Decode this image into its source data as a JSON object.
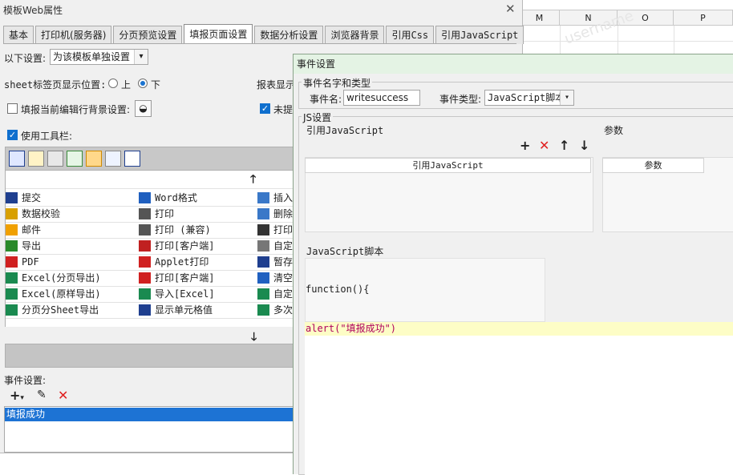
{
  "main": {
    "title": "模板Web属性",
    "tabs": [
      "基本",
      "打印机(服务器)",
      "分页预览设置",
      "填报页面设置",
      "数据分析设置",
      "浏览器背景",
      "引用Css",
      "引用JavaScript"
    ],
    "settings_label": "以下设置:",
    "settings_combo": "为该模板单独设置",
    "sheet_pos_label": "sheet标签页显示位置:",
    "radio_up": "上",
    "radio_down": "下",
    "report_display_label": "报表显示",
    "edit_row_bg_label": "填报当前编辑行背景设置:",
    "no_prompt_label": "未提",
    "use_toolbar_label": "使用工具栏:",
    "buttons": [
      [
        "提交",
        "Word格式",
        "插入"
      ],
      [
        "数据校验",
        "打印",
        "删除"
      ],
      [
        "邮件",
        "打印 (兼容)",
        "打印"
      ],
      [
        "导出",
        "打印[客户端]",
        "自定"
      ],
      [
        "PDF",
        "Applet打印",
        "暂存"
      ],
      [
        "Excel(分页导出)",
        "打印[客户端]",
        "清空"
      ],
      [
        "Excel(原样导出)",
        "导入[Excel]",
        "自定"
      ],
      [
        "分页分Sheet导出",
        "显示单元格值",
        "多次"
      ]
    ],
    "event_settings_label": "事件设置:",
    "event_item": "填报成功"
  },
  "sheet": {
    "columns": [
      "M",
      "N",
      "O",
      "P"
    ],
    "watermark": "username"
  },
  "event_dialog": {
    "title": "事件设置",
    "name_type_legend": "事件名字和类型",
    "event_name_label": "事件名:",
    "event_name_value": "writesuccess",
    "event_type_label": "事件类型:",
    "event_type_value": "JavaScript脚本",
    "js_legend": "JS设置",
    "ref_js_label": "引用JavaScript",
    "params_label": "参数",
    "ref_js_col": "引用JavaScript",
    "params_col": "参数",
    "script_label": "JavaScript脚本",
    "func_line": "function(){",
    "script_line": "alert(\"填报成功\")"
  }
}
